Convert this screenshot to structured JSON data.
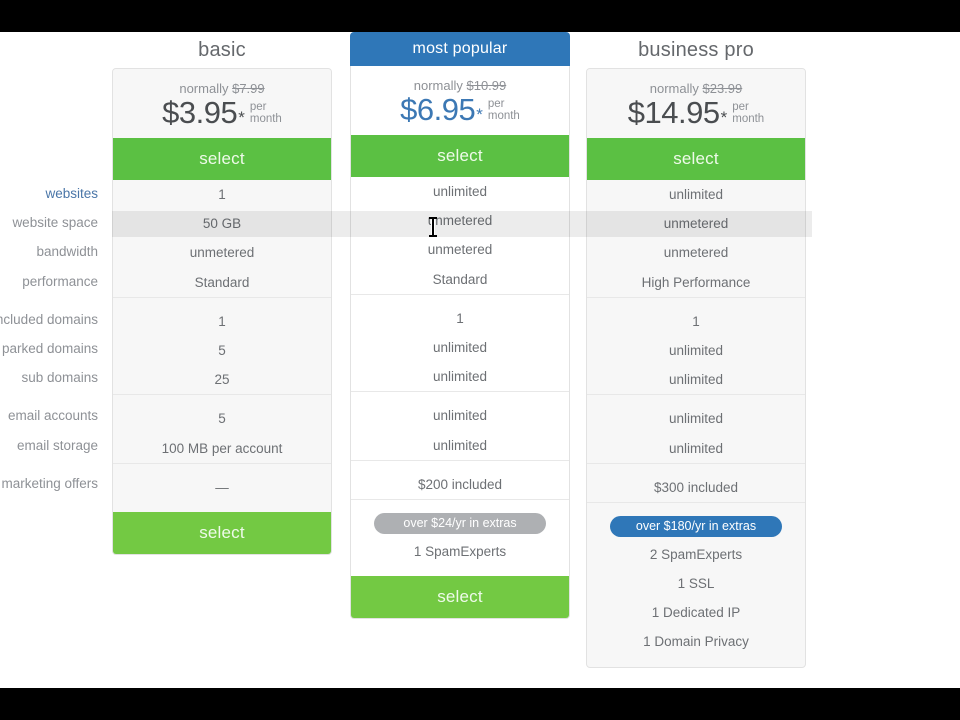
{
  "sidebar": {
    "labels": [
      {
        "text": "websites",
        "active": true
      },
      {
        "text": "website space",
        "active": false
      },
      {
        "text": "bandwidth",
        "active": false
      },
      {
        "text": "performance",
        "active": false
      },
      {
        "text": "included domains",
        "active": false
      },
      {
        "text": "parked domains",
        "active": false
      },
      {
        "text": "sub domains",
        "active": false
      },
      {
        "text": "email accounts",
        "active": false
      },
      {
        "text": "email storage",
        "active": false
      },
      {
        "text": "marketing offers",
        "active": false
      }
    ]
  },
  "colors": {
    "green": "#5bc043",
    "green_bottom": "#73c943",
    "blue": "#2f77b8",
    "price_blue": "#3c78b4",
    "gray_pill": "#aeb0b3",
    "text": "#6d7074",
    "muted": "#8e9196",
    "card_bg": "#f7f7f7"
  },
  "plans": [
    {
      "id": "basic",
      "title": "basic",
      "ribbon": null,
      "normally_prefix": "normally",
      "normally_price": "$7.99",
      "price": "$3.95",
      "asterisk": "*",
      "per": "per",
      "month": "month",
      "price_blue": false,
      "select_label": "select",
      "features_group1": [
        "1",
        "50 GB",
        "unmetered",
        "Standard"
      ],
      "features_group2": [
        "1",
        "5",
        "25"
      ],
      "features_group3": [
        "5",
        "100 MB per account"
      ],
      "features_group4": [
        "—"
      ],
      "badge": null,
      "extras": [],
      "bottom_select_label": "select",
      "has_bottom_select": true
    },
    {
      "id": "most-popular",
      "title": null,
      "ribbon": "most popular",
      "normally_prefix": "normally",
      "normally_price": "$10.99",
      "price": "$6.95",
      "asterisk": "*",
      "per": "per",
      "month": "month",
      "price_blue": true,
      "select_label": "select",
      "features_group1": [
        "unlimited",
        "unmetered",
        "unmetered",
        "Standard"
      ],
      "features_group2": [
        "1",
        "unlimited",
        "unlimited"
      ],
      "features_group3": [
        "unlimited",
        "unlimited"
      ],
      "features_group4": [
        "$200 included"
      ],
      "badge": {
        "text": "over $24/yr in extras",
        "style": "gray"
      },
      "extras": [
        "1 SpamExperts"
      ],
      "bottom_select_label": "select",
      "has_bottom_select": true
    },
    {
      "id": "business-pro",
      "title": "business pro",
      "ribbon": null,
      "normally_prefix": "normally",
      "normally_price": "$23.99",
      "price": "$14.95",
      "asterisk": "*",
      "per": "per",
      "month": "month",
      "price_blue": false,
      "select_label": "select",
      "features_group1": [
        "unlimited",
        "unmetered",
        "unmetered",
        "High Performance"
      ],
      "features_group2": [
        "1",
        "unlimited",
        "unlimited"
      ],
      "features_group3": [
        "unlimited",
        "unlimited"
      ],
      "features_group4": [
        "$300 included"
      ],
      "badge": {
        "text": "over $180/yr in extras",
        "style": "blue"
      },
      "extras": [
        "2 SpamExperts",
        "1 SSL",
        "1 Dedicated IP",
        "1 Domain Privacy"
      ],
      "bottom_select_label": null,
      "has_bottom_select": false
    }
  ]
}
